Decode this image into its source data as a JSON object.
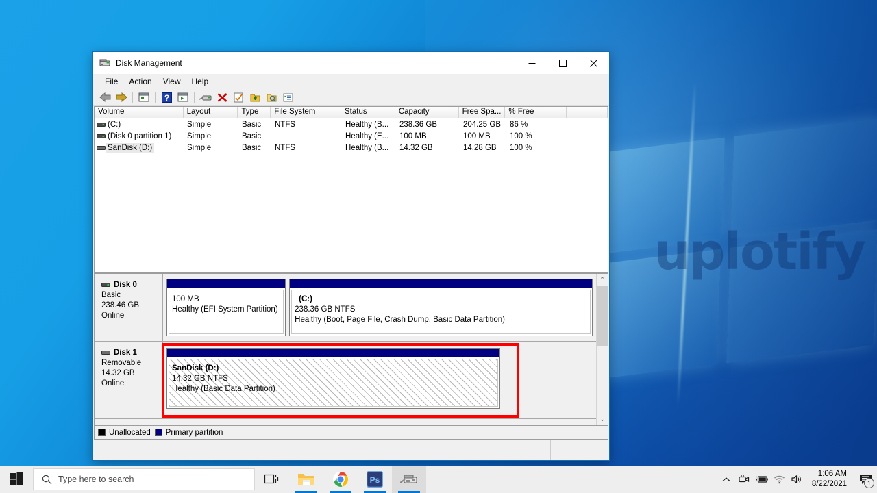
{
  "desktop": {
    "watermark": "uplotify"
  },
  "window": {
    "title": "Disk Management",
    "title_icon": "disk-management-icon",
    "controls": {
      "minimize": "─",
      "maximize": "□",
      "close": "✕"
    },
    "menus": [
      "File",
      "Action",
      "View",
      "Help"
    ],
    "toolbar_icons": [
      "back-arrow-icon",
      "forward-arrow-icon",
      "separator",
      "up-one-level-icon",
      "separator",
      "help-icon",
      "show-console-tree-icon",
      "separator",
      "disk-icon",
      "delete-icon",
      "properties-icon",
      "export-list-icon",
      "find-icon",
      "refresh-icon"
    ]
  },
  "volume_list": {
    "columns": [
      "Volume",
      "Layout",
      "Type",
      "File System",
      "Status",
      "Capacity",
      "Free Spa...",
      "% Free"
    ],
    "rows": [
      {
        "icon": "volume-drive-icon",
        "volume": "(C:)",
        "selected": false,
        "layout": "Simple",
        "type": "Basic",
        "file_system": "NTFS",
        "status": "Healthy (B...",
        "capacity": "238.36 GB",
        "free_space": "204.25 GB",
        "percent_free": "86 %"
      },
      {
        "icon": "volume-drive-icon",
        "volume": "(Disk 0 partition 1)",
        "selected": false,
        "layout": "Simple",
        "type": "Basic",
        "file_system": "",
        "status": "Healthy (E...",
        "capacity": "100 MB",
        "free_space": "100 MB",
        "percent_free": "100 %"
      },
      {
        "icon": "volume-removable-icon",
        "volume": "SanDisk (D:)",
        "selected": true,
        "layout": "Simple",
        "type": "Basic",
        "file_system": "NTFS",
        "status": "Healthy (B...",
        "capacity": "14.32 GB",
        "free_space": "14.28 GB",
        "percent_free": "100 %"
      }
    ]
  },
  "graphical_view": {
    "disks": [
      {
        "icon": "disk-icon",
        "name": "Disk 0",
        "type": "Basic",
        "size": "238.46 GB",
        "state": "Online",
        "partitions": [
          {
            "title": "",
            "size_line": "100 MB",
            "status_line": "Healthy (EFI System Partition)",
            "width_pct": 28,
            "selected": false
          },
          {
            "title": "(C:)",
            "size_line": "238.36 GB NTFS",
            "status_line": "Healthy (Boot, Page File, Crash Dump, Basic Data Partition)",
            "width_pct": 72,
            "selected": false
          }
        ]
      },
      {
        "icon": "removable-disk-icon",
        "name": "Disk 1",
        "type": "Removable",
        "size": "14.32 GB",
        "state": "Online",
        "partitions": [
          {
            "title": "SanDisk  (D:)",
            "size_line": "14.32 GB NTFS",
            "status_line": "Healthy (Basic Data Partition)",
            "width_pct": 100,
            "selected": true
          }
        ]
      }
    ],
    "annotation": {
      "shape": "rectangle",
      "color": "#ff0000"
    },
    "scrollbar": {
      "up": "⌃",
      "down": "⌄"
    }
  },
  "legend": [
    {
      "label": "Unallocated",
      "color": "#000000"
    },
    {
      "label": "Primary partition",
      "color": "#000080"
    }
  ],
  "taskbar": {
    "start": "start-icon",
    "search": {
      "icon": "search-icon",
      "placeholder": "Type here to search",
      "value": ""
    },
    "apps": [
      {
        "name": "task-view-icon",
        "running": false,
        "active": false
      },
      {
        "name": "file-explorer-icon",
        "running": true,
        "active": false
      },
      {
        "name": "google-chrome-icon",
        "running": true,
        "active": false
      },
      {
        "name": "photoshop-icon",
        "running": true,
        "active": false,
        "label": "Ps"
      },
      {
        "name": "disk-management-icon",
        "running": true,
        "active": true
      }
    ],
    "tray": [
      "chevron-up-icon",
      "webcam-icon",
      "battery-charging-icon",
      "wifi-icon",
      "volume-icon"
    ],
    "clock": {
      "time": "1:06 AM",
      "date": "8/22/2021"
    },
    "notifications": {
      "icon": "notification-icon",
      "count": "1"
    }
  }
}
